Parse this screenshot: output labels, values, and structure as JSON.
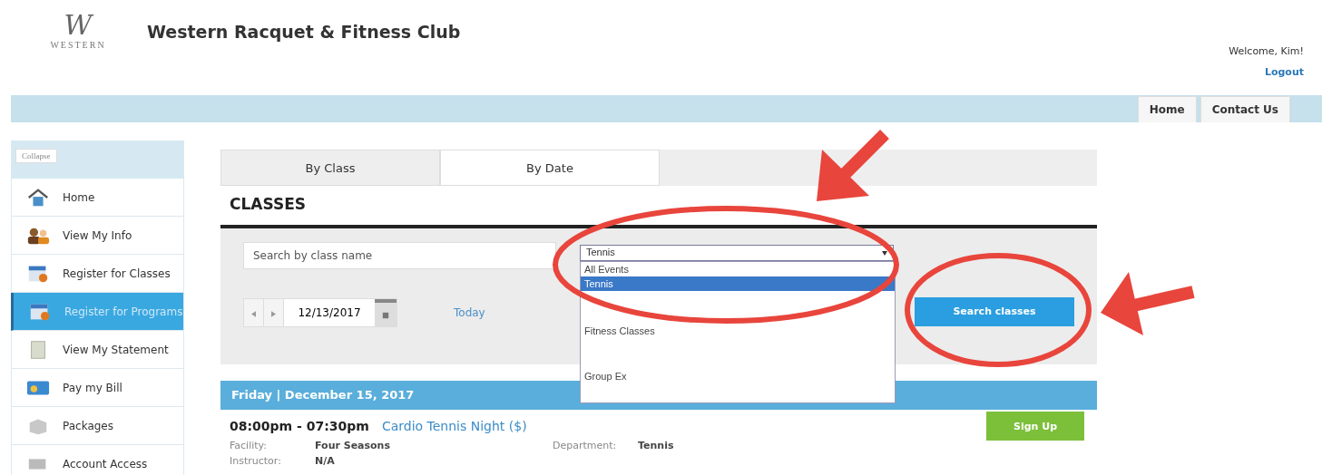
{
  "header": {
    "logo_initial": "W",
    "logo_text": "WESTERN",
    "title": "Western Racquet & Fitness Club",
    "welcome": "Welcome, Kim!",
    "logout": "Logout"
  },
  "nav_tabs": [
    {
      "label": "Home"
    },
    {
      "label": "Contact Us"
    }
  ],
  "sidebar": {
    "collapse": "Collapse",
    "items": [
      {
        "label": "Home",
        "kind": "house",
        "selected": false
      },
      {
        "label": "View My Info",
        "kind": "people",
        "selected": false
      },
      {
        "label": "Register for Classes",
        "kind": "calendar",
        "selected": false
      },
      {
        "label": "Register for Programs",
        "kind": "calendar",
        "selected": true
      },
      {
        "label": "View My Statement",
        "kind": "sheet",
        "selected": false
      },
      {
        "label": "Pay my Bill",
        "kind": "card",
        "selected": false
      },
      {
        "label": "Packages",
        "kind": "box",
        "selected": false
      },
      {
        "label": "Account Access",
        "kind": "key",
        "selected": false
      }
    ]
  },
  "view_tabs": [
    {
      "label": "By Class",
      "selected": false
    },
    {
      "label": "By Date",
      "selected": true
    }
  ],
  "heading": "CLASSES",
  "filters": {
    "search_placeholder": "Search by class name",
    "category": "Tennis",
    "options": [
      {
        "label": "All Events",
        "selected": false
      },
      {
        "label": "Tennis",
        "selected": true
      },
      {
        "label": "Fitness Classes",
        "selected": false
      },
      {
        "label": "Group Ex",
        "selected": false
      }
    ],
    "date": "12/13/2017",
    "today": "Today",
    "search_button": "Search classes"
  },
  "day_header": "Friday | December 15, 2017",
  "events": [
    {
      "time": "08:00pm - 07:30pm",
      "title": "Cardio Tennis Night ($)",
      "button": "Sign Up",
      "facility_label": "Facility:",
      "facility": "Four Seasons",
      "department_label": "Department:",
      "department": "Tennis",
      "instructor_label": "Instructor:",
      "instructor": "N/A"
    }
  ]
}
